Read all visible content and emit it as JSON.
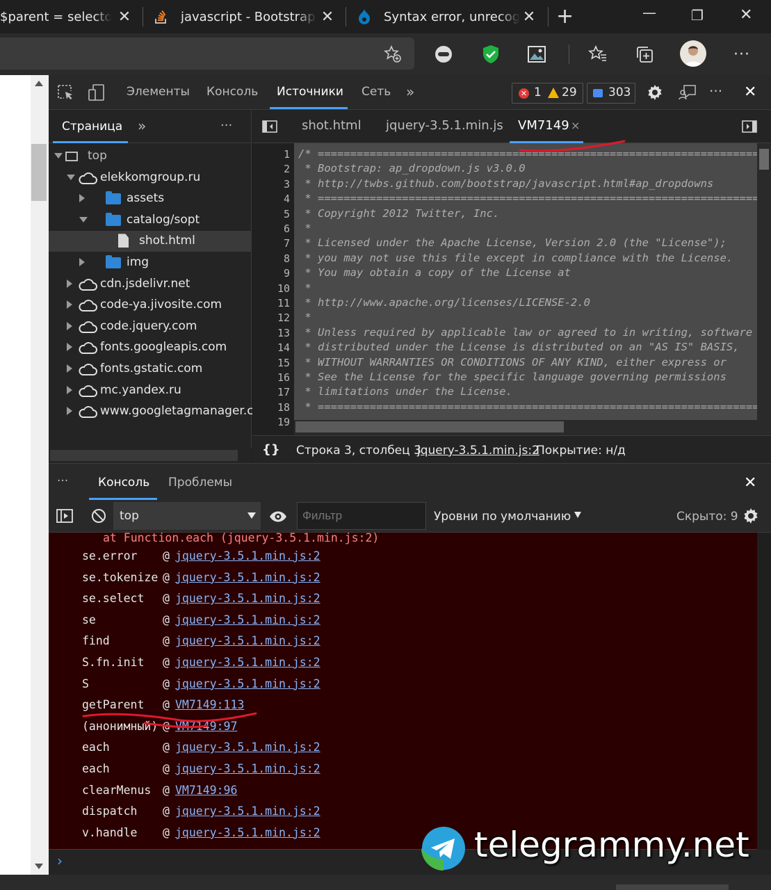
{
  "browser": {
    "tabs": [
      {
        "label": "$parent = selector &",
        "icon": "none"
      },
      {
        "label": "javascript - Bootstrap d",
        "icon": "stackoverflow-icon"
      },
      {
        "label": "Syntax error, unrecogni",
        "icon": "drupal-icon"
      }
    ],
    "new_tab": "+",
    "window_controls": {
      "minimize": "—",
      "restore": "❐",
      "close": "✕"
    },
    "toolbar_menu": "···"
  },
  "devtools": {
    "top_tabs": [
      "Элементы",
      "Консоль",
      "Источники",
      "Сеть"
    ],
    "active_top_tab": "Источники",
    "more_tabs": "»",
    "counters": {
      "errors": "1",
      "warnings": "29",
      "messages": "303"
    },
    "navigator": {
      "tab": "Страница",
      "more": "»",
      "menu": "···",
      "tree": [
        {
          "label": "top",
          "type": "frame",
          "depth": 0,
          "arrow": "down"
        },
        {
          "label": "elekkomgroup.ru",
          "type": "cloud",
          "depth": 1,
          "arrow": "down"
        },
        {
          "label": "assets",
          "type": "folder",
          "depth": 2,
          "arrow": "right"
        },
        {
          "label": "catalog/sopt",
          "type": "folder",
          "depth": 2,
          "arrow": "down"
        },
        {
          "label": "shot.html",
          "type": "file",
          "depth": 3,
          "arrow": "none",
          "selected": true
        },
        {
          "label": "img",
          "type": "folder",
          "depth": 2,
          "arrow": "right"
        },
        {
          "label": "cdn.jsdelivr.net",
          "type": "cloud",
          "depth": 1,
          "arrow": "right"
        },
        {
          "label": "code-ya.jivosite.com",
          "type": "cloud",
          "depth": 1,
          "arrow": "right"
        },
        {
          "label": "code.jquery.com",
          "type": "cloud",
          "depth": 1,
          "arrow": "right"
        },
        {
          "label": "fonts.googleapis.com",
          "type": "cloud",
          "depth": 1,
          "arrow": "right"
        },
        {
          "label": "fonts.gstatic.com",
          "type": "cloud",
          "depth": 1,
          "arrow": "right"
        },
        {
          "label": "mc.yandex.ru",
          "type": "cloud",
          "depth": 1,
          "arrow": "right"
        },
        {
          "label": "www.googletagmanager.cc",
          "type": "cloud",
          "depth": 1,
          "arrow": "right"
        }
      ]
    },
    "editor": {
      "tabs": [
        "shot.html",
        "jquery-3.5.1.min.js",
        "VM7149"
      ],
      "active_tab": "VM7149",
      "tab_close": "×",
      "lines": [
        {
          "n": "1",
          "t": "/* ========================================================================"
        },
        {
          "n": "2",
          "t": " * Bootstrap: ap_dropdown.js v3.0.0"
        },
        {
          "n": "3",
          "t": " * http://twbs.github.com/bootstrap/javascript.html#ap_dropdowns"
        },
        {
          "n": "4",
          "t": " * ========================================================================"
        },
        {
          "n": "5",
          "t": " * Copyright 2012 Twitter, Inc."
        },
        {
          "n": "6",
          "t": " *"
        },
        {
          "n": "7",
          "t": " * Licensed under the Apache License, Version 2.0 (the \"License\");"
        },
        {
          "n": "8",
          "t": " * you may not use this file except in compliance with the License."
        },
        {
          "n": "9",
          "t": " * You may obtain a copy of the License at"
        },
        {
          "n": "10",
          "t": " *"
        },
        {
          "n": "11",
          "t": " * http://www.apache.org/licenses/LICENSE-2.0"
        },
        {
          "n": "12",
          "t": " *"
        },
        {
          "n": "13",
          "t": " * Unless required by applicable law or agreed to in writing, software"
        },
        {
          "n": "14",
          "t": " * distributed under the License is distributed on an \"AS IS\" BASIS,"
        },
        {
          "n": "15",
          "t": " * WITHOUT WARRANTIES OR CONDITIONS OF ANY KIND, either express or"
        },
        {
          "n": "16",
          "t": " * See the License for the specific language governing permissions"
        },
        {
          "n": "17",
          "t": " * limitations under the License."
        },
        {
          "n": "18",
          "t": " * ========================================================================"
        },
        {
          "n": "19",
          "t": ""
        }
      ]
    },
    "status": {
      "braces": "{}",
      "position": "Строка 3, столбец 3",
      "source_link": "jquery-3.5.1.min.js:2",
      "coverage": "Покрытие: н/д"
    },
    "drawer": {
      "menu": "···",
      "tabs": [
        "Консоль",
        "Проблемы"
      ],
      "active_tab": "Консоль",
      "close": "✕"
    },
    "console_toolbar": {
      "context": "top",
      "filter_placeholder": "Фильтр",
      "levels": "Уровни по умолчанию",
      "hidden": "Скрыто: 9"
    },
    "console_output": {
      "first_line": "at Function.each (jquery-3.5.1.min.js:2)",
      "stack": [
        {
          "fn": "se.error",
          "src": "jquery-3.5.1.min.js:2"
        },
        {
          "fn": "se.tokenize",
          "src": "jquery-3.5.1.min.js:2"
        },
        {
          "fn": "se.select",
          "src": "jquery-3.5.1.min.js:2"
        },
        {
          "fn": "se",
          "src": "jquery-3.5.1.min.js:2"
        },
        {
          "fn": "find",
          "src": "jquery-3.5.1.min.js:2"
        },
        {
          "fn": "S.fn.init",
          "src": "jquery-3.5.1.min.js:2"
        },
        {
          "fn": "S",
          "src": "jquery-3.5.1.min.js:2"
        },
        {
          "fn": "getParent",
          "src": "VM7149:113"
        },
        {
          "fn": "(анонимный)",
          "src": "VM7149:97"
        },
        {
          "fn": "each",
          "src": "jquery-3.5.1.min.js:2"
        },
        {
          "fn": "each",
          "src": "jquery-3.5.1.min.js:2"
        },
        {
          "fn": "clearMenus",
          "src": "VM7149:96"
        },
        {
          "fn": "dispatch",
          "src": "jquery-3.5.1.min.js:2"
        },
        {
          "fn": "v.handle",
          "src": "jquery-3.5.1.min.js:2"
        }
      ],
      "at_sign": "@",
      "prompt": "›"
    }
  },
  "watermark": {
    "text": "telegrammy.net"
  },
  "colors": {
    "accent": "#4aa1ff",
    "error_bg": "#2a0000",
    "error_text": "#ff8080",
    "link": "#8ab4f8",
    "annotation": "#e0192b"
  }
}
